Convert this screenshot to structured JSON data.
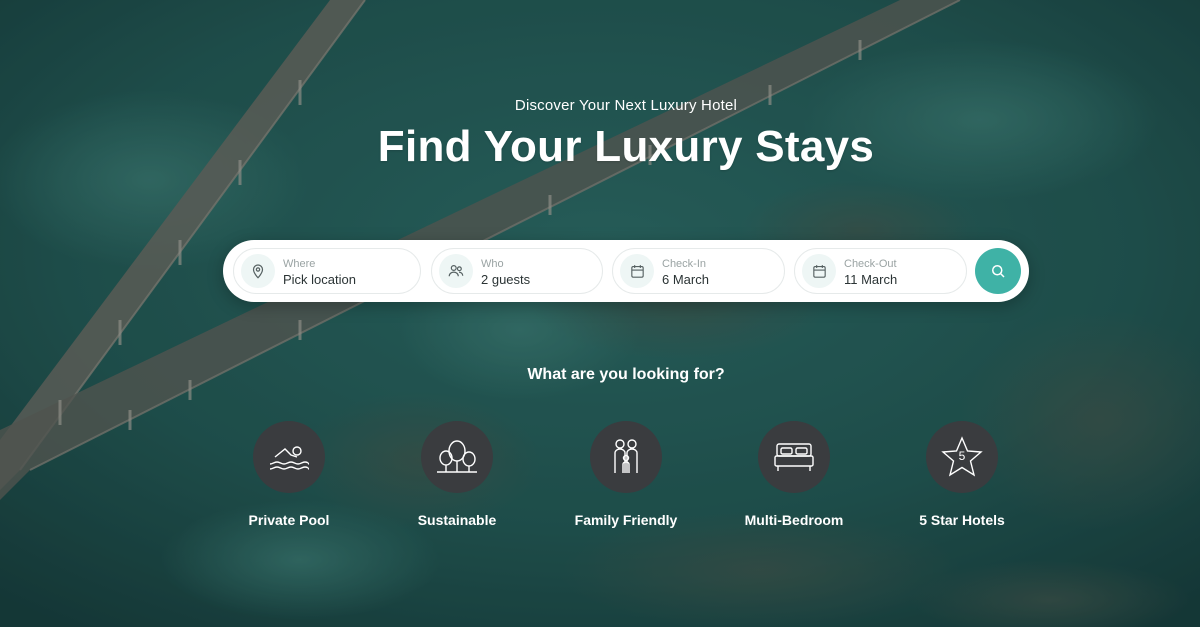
{
  "hero": {
    "subtitle": "Discover Your Next Luxury Hotel",
    "title": "Find Your Luxury Stays"
  },
  "search": {
    "fields": [
      {
        "label": "Where",
        "value": "Pick location",
        "icon": "location-pin-icon"
      },
      {
        "label": "Who",
        "value": "2 guests",
        "icon": "users-icon"
      },
      {
        "label": "Check-In",
        "value": "6 March",
        "icon": "calendar-icon"
      },
      {
        "label": "Check-Out",
        "value": "11 March",
        "icon": "calendar-icon"
      }
    ],
    "button_icon": "search-icon"
  },
  "categories": {
    "heading": "What are you looking for?",
    "items": [
      {
        "label": "Private Pool",
        "icon": "swimmer-icon"
      },
      {
        "label": "Sustainable",
        "icon": "trees-icon"
      },
      {
        "label": "Family Friendly",
        "icon": "family-icon"
      },
      {
        "label": "Multi-Bedroom",
        "icon": "bed-icon"
      },
      {
        "label": "5 Star Hotels",
        "icon": "star-5-icon",
        "icon_text": "5"
      }
    ]
  },
  "colors": {
    "accent": "#3fb2a6",
    "category_circle": "#3a3c3f",
    "water_dark": "#1f4b48"
  }
}
